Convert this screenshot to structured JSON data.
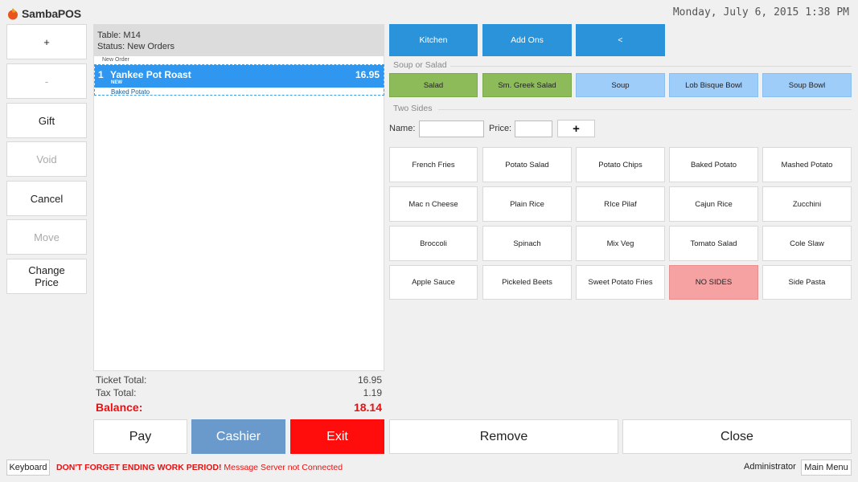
{
  "app": {
    "logo_text": "SambaPOS",
    "datetime": "Monday, July 6, 2015 1:38 PM"
  },
  "left_buttons": {
    "plus": "+",
    "minus": "-",
    "gift": "Gift",
    "void": "Void",
    "cancel": "Cancel",
    "move": "Move",
    "change_price_1": "Change",
    "change_price_2": "Price"
  },
  "ticket": {
    "table": "Table: M14",
    "status": "Status: New Orders",
    "order_group": "New Order",
    "order": {
      "qty": "1",
      "name": "Yankee Pot Roast",
      "price": "16.95",
      "badge": "NEW",
      "modifier": "Baked Potato"
    },
    "totals": {
      "ticket_total_label": "Ticket Total:",
      "ticket_total": "16.95",
      "tax_total_label": "Tax Total:",
      "tax_total": "1.19",
      "balance_label": "Balance:",
      "balance": "18.14"
    }
  },
  "menu": {
    "top": [
      "Kitchen",
      "Add Ons",
      "<"
    ],
    "soup_section": "Soup or Salad",
    "soup_items": [
      "Salad",
      "Sm. Greek Salad",
      "Soup",
      "Lob Bisque Bowl",
      "Soup Bowl"
    ],
    "sides_section": "Two Sides",
    "name_label": "Name:",
    "price_label": "Price:",
    "add_label": "+",
    "sides": [
      "French Fries",
      "Potato Salad",
      "Potato Chips",
      "Baked Potato",
      "Mashed Potato",
      "Mac n Cheese",
      "Plain Rice",
      "RIce Pilaf",
      "Cajun Rice",
      "Zucchini",
      "Broccoli",
      "Spinach",
      "Mix Veg",
      "Tomato Salad",
      "Cole Slaw",
      "Apple Sauce",
      "Pickeled Beets",
      "Sweet Potato Fries",
      "NO SIDES",
      "Side Pasta"
    ]
  },
  "actions": {
    "pay": "Pay",
    "cashier": "Cashier",
    "exit": "Exit",
    "remove": "Remove",
    "close": "Close"
  },
  "footer": {
    "keyboard": "Keyboard",
    "warning_bold": "DON'T FORGET ENDING WORK PERIOD!",
    "warning_msg": " Message Server not Connected",
    "user": "Administrator",
    "main_menu": "Main Menu"
  },
  "colors": {
    "accent_blue": "#2a93da",
    "selected_row": "#2f97f0",
    "green": "#8dbb5a",
    "light_blue": "#9ecdfa",
    "pink": "#f7a2a2",
    "cashier": "#6a99cc",
    "exit": "#ff0d0d",
    "balance": "#e81010"
  }
}
